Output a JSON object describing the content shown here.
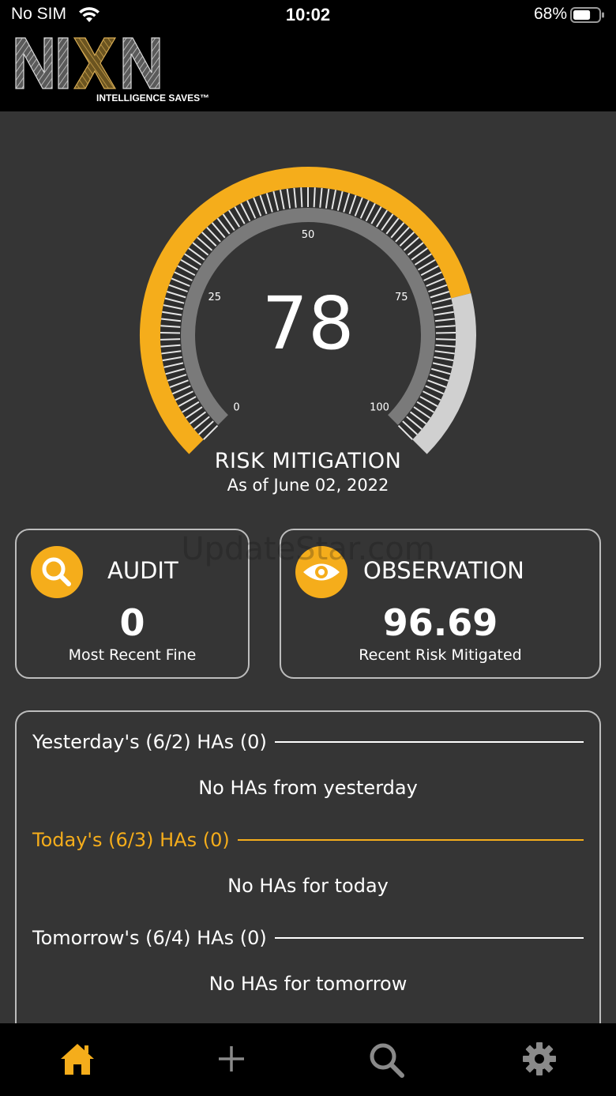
{
  "status_bar": {
    "carrier": "No SIM",
    "time": "10:02",
    "battery_percent": "68%",
    "battery_level": 0.68
  },
  "header": {
    "logo_text": "NIXN",
    "tagline": "INTELLIGENCE SAVES™"
  },
  "gauge": {
    "value": "78",
    "value_number": 78,
    "min": 0,
    "max": 100,
    "tick_labels": [
      "0",
      "25",
      "50",
      "75",
      "100"
    ],
    "title": "RISK MITIGATION",
    "date": "As of June 02, 2022",
    "accent_color": "#f5ad1b",
    "remainder_color": "#d0d0d0"
  },
  "cards": {
    "audit": {
      "title": "AUDIT",
      "value": "0",
      "subtitle": "Most Recent Fine",
      "icon": "search-icon"
    },
    "observation": {
      "title": "OBSERVATION",
      "value": "96.69",
      "subtitle": "Recent Risk Mitigated",
      "icon": "eye-icon"
    }
  },
  "watermark": "UpdateStar.com",
  "ha_sections": {
    "yesterday": {
      "heading": "Yesterday's (6/2) HAs (0)",
      "empty": "No HAs from yesterday"
    },
    "today": {
      "heading": "Today's (6/3) HAs (0)",
      "empty": "No HAs for today"
    },
    "tomorrow": {
      "heading": "Tomorrow's (6/4) HAs (0)",
      "empty": "No HAs for tomorrow"
    }
  },
  "bottom_nav": {
    "items": [
      {
        "name": "home",
        "icon": "home-icon",
        "active": true
      },
      {
        "name": "add",
        "icon": "plus-icon",
        "active": false
      },
      {
        "name": "search",
        "icon": "search-icon",
        "active": false
      },
      {
        "name": "settings",
        "icon": "gear-icon",
        "active": false
      }
    ],
    "active_color": "#f5ad1b",
    "inactive_color": "#8a8a8a"
  }
}
